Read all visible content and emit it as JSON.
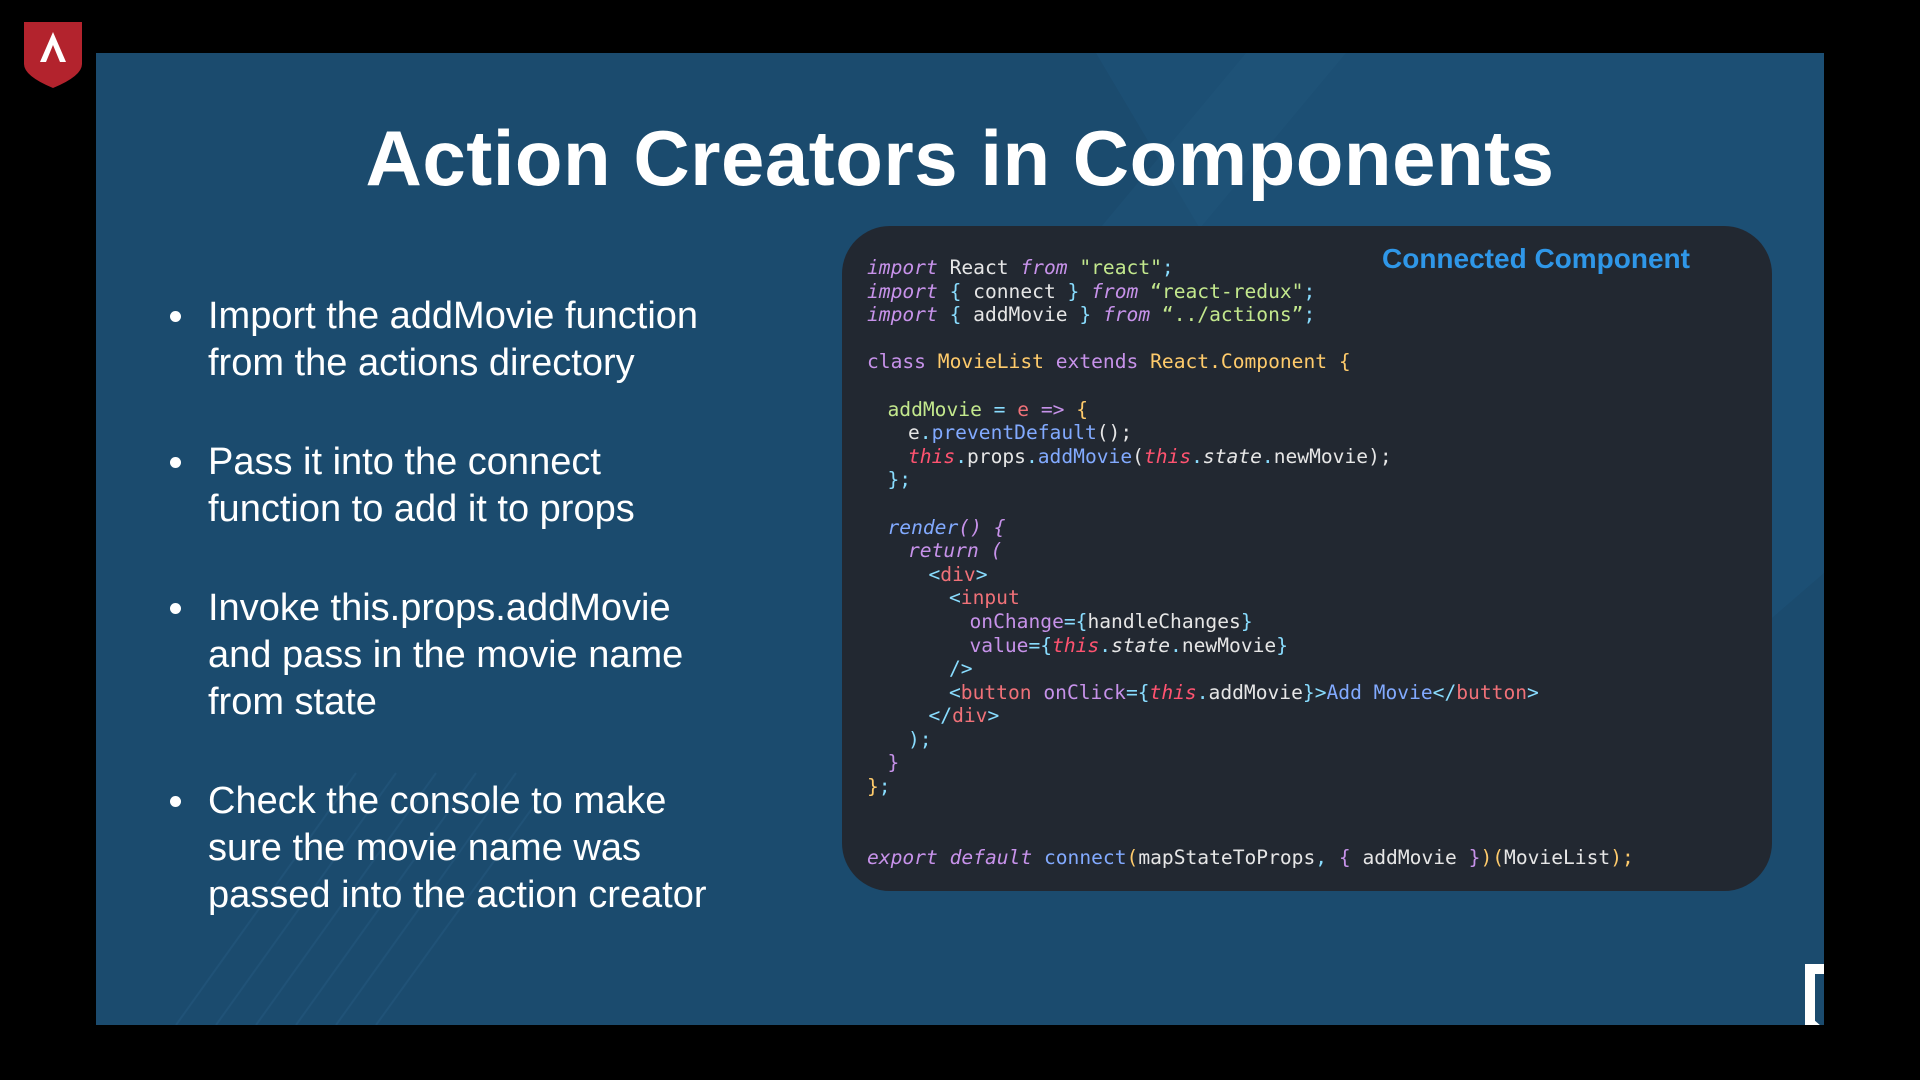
{
  "slide": {
    "title": "Action Creators in Components",
    "bullets": [
      "Import the addMovie function\nfrom the actions directory",
      "Pass it into the connect\nfunction to add it to props",
      "Invoke this.props.addMovie\nand pass in the movie name\nfrom state",
      "Check the console to make\nsure the movie name was\npassed into the action creator"
    ]
  },
  "code_panel": {
    "label": "Connected Component",
    "lines": [
      {
        "indent": 0,
        "tokens": [
          {
            "t": "import",
            "c": "kw"
          },
          {
            "t": " React ",
            "c": "plain"
          },
          {
            "t": "from",
            "c": "kw"
          },
          {
            "t": " \"react\"",
            "c": "str"
          },
          {
            "t": ";",
            "c": "punc"
          }
        ]
      },
      {
        "indent": 0,
        "tokens": [
          {
            "t": "import",
            "c": "kw"
          },
          {
            "t": " { ",
            "c": "punc"
          },
          {
            "t": "connect",
            "c": "plain"
          },
          {
            "t": " } ",
            "c": "punc"
          },
          {
            "t": "from",
            "c": "kw"
          },
          {
            "t": " “react-redux\"",
            "c": "str"
          },
          {
            "t": ";",
            "c": "punc"
          }
        ]
      },
      {
        "indent": 0,
        "tokens": [
          {
            "t": "import",
            "c": "kw"
          },
          {
            "t": " { ",
            "c": "punc"
          },
          {
            "t": "addMovie",
            "c": "plain"
          },
          {
            "t": " } ",
            "c": "punc"
          },
          {
            "t": "from",
            "c": "kw"
          },
          {
            "t": " “../actions”",
            "c": "str"
          },
          {
            "t": ";",
            "c": "punc"
          }
        ]
      },
      {
        "indent": 0,
        "tokens": []
      },
      {
        "indent": 0,
        "tokens": [
          {
            "t": "class",
            "c": "key"
          },
          {
            "t": " MovieList ",
            "c": "cls"
          },
          {
            "t": "extends",
            "c": "key"
          },
          {
            "t": " React.Component ",
            "c": "cls"
          },
          {
            "t": "{",
            "c": "brace"
          }
        ]
      },
      {
        "indent": 0,
        "tokens": []
      },
      {
        "indent": 1,
        "tokens": [
          {
            "t": "addMovie",
            "c": "def"
          },
          {
            "t": " = ",
            "c": "punc"
          },
          {
            "t": "e",
            "c": "tag"
          },
          {
            "t": " => ",
            "c": "key"
          },
          {
            "t": "{",
            "c": "brace"
          }
        ]
      },
      {
        "indent": 2,
        "tokens": [
          {
            "t": "e",
            "c": "plain"
          },
          {
            "t": ".",
            "c": "punc"
          },
          {
            "t": "preventDefault",
            "c": "fn"
          },
          {
            "t": "();",
            "c": "plain"
          }
        ]
      },
      {
        "indent": 2,
        "tokens": [
          {
            "t": "this",
            "c": "this"
          },
          {
            "t": ".",
            "c": "punc"
          },
          {
            "t": "props",
            "c": "plain"
          },
          {
            "t": ".",
            "c": "punc"
          },
          {
            "t": "addMovie",
            "c": "fn"
          },
          {
            "t": "(",
            "c": "plain"
          },
          {
            "t": "this",
            "c": "this"
          },
          {
            "t": ".",
            "c": "punc"
          },
          {
            "t": "state",
            "c": "ital"
          },
          {
            "t": ".",
            "c": "punc"
          },
          {
            "t": "newMovie",
            "c": "plain"
          },
          {
            "t": ");",
            "c": "plain"
          }
        ]
      },
      {
        "indent": 1,
        "tokens": [
          {
            "t": "};",
            "c": "punc"
          }
        ]
      },
      {
        "indent": 0,
        "tokens": []
      },
      {
        "indent": 1,
        "tokens": [
          {
            "t": "render",
            "c": "rfn"
          },
          {
            "t": "() ",
            "c": "kw"
          },
          {
            "t": "{",
            "c": "kw"
          }
        ]
      },
      {
        "indent": 2,
        "tokens": [
          {
            "t": "return",
            "c": "kw"
          },
          {
            "t": " (",
            "c": "kw"
          }
        ]
      },
      {
        "indent": 3,
        "tokens": [
          {
            "t": "<",
            "c": "punc"
          },
          {
            "t": "div",
            "c": "tag"
          },
          {
            "t": ">",
            "c": "punc"
          }
        ]
      },
      {
        "indent": 4,
        "tokens": [
          {
            "t": "<",
            "c": "punc"
          },
          {
            "t": "input",
            "c": "tag"
          }
        ]
      },
      {
        "indent": 5,
        "tokens": [
          {
            "t": "onChange",
            "c": "attr"
          },
          {
            "t": "={",
            "c": "punc"
          },
          {
            "t": "handleChanges",
            "c": "plain"
          },
          {
            "t": "}",
            "c": "punc"
          }
        ]
      },
      {
        "indent": 5,
        "tokens": [
          {
            "t": "value",
            "c": "attr"
          },
          {
            "t": "={",
            "c": "punc"
          },
          {
            "t": "this",
            "c": "this"
          },
          {
            "t": ".",
            "c": "punc"
          },
          {
            "t": "state",
            "c": "ital"
          },
          {
            "t": ".",
            "c": "punc"
          },
          {
            "t": "newMovie",
            "c": "plain"
          },
          {
            "t": "}",
            "c": "punc"
          }
        ]
      },
      {
        "indent": 4,
        "tokens": [
          {
            "t": "/>",
            "c": "punc"
          }
        ]
      },
      {
        "indent": 4,
        "tokens": [
          {
            "t": "<",
            "c": "punc"
          },
          {
            "t": "button",
            "c": "tag"
          },
          {
            "t": " onClick",
            "c": "attr"
          },
          {
            "t": "={",
            "c": "punc"
          },
          {
            "t": "this",
            "c": "this"
          },
          {
            "t": ".",
            "c": "punc"
          },
          {
            "t": "addMovie",
            "c": "plain"
          },
          {
            "t": "}>",
            "c": "punc"
          },
          {
            "t": "Add Movie",
            "c": "text"
          },
          {
            "t": "</",
            "c": "punc"
          },
          {
            "t": "button",
            "c": "tag"
          },
          {
            "t": ">",
            "c": "punc"
          }
        ]
      },
      {
        "indent": 3,
        "tokens": [
          {
            "t": "</",
            "c": "punc"
          },
          {
            "t": "div",
            "c": "tag"
          },
          {
            "t": ">",
            "c": "punc"
          }
        ]
      },
      {
        "indent": 2,
        "tokens": [
          {
            "t": ");",
            "c": "punc"
          }
        ]
      },
      {
        "indent": 1,
        "tokens": [
          {
            "t": "}",
            "c": "key"
          }
        ]
      },
      {
        "indent": 0,
        "tokens": [
          {
            "t": "}",
            "c": "brace"
          },
          {
            "t": ";",
            "c": "punc"
          }
        ]
      },
      {
        "indent": 0,
        "tokens": []
      },
      {
        "indent": 0,
        "tokens": []
      },
      {
        "indent": 0,
        "tokens": [
          {
            "t": "export",
            "c": "kw"
          },
          {
            "t": " default",
            "c": "kw"
          },
          {
            "t": " connect",
            "c": "fn"
          },
          {
            "t": "(",
            "c": "brace"
          },
          {
            "t": "mapStateToProps",
            "c": "plain"
          },
          {
            "t": ", ",
            "c": "punc"
          },
          {
            "t": "{ ",
            "c": "key"
          },
          {
            "t": "addMovie",
            "c": "plain"
          },
          {
            "t": " }",
            "c": "key"
          },
          {
            "t": ")(",
            "c": "brace"
          },
          {
            "t": "MovieList",
            "c": "plain"
          },
          {
            "t": ");",
            "c": "brace"
          }
        ]
      }
    ]
  },
  "icons": {
    "corner_badge": "lambda-shield-icon",
    "brand_logo": "lambda-shield-outline-icon"
  },
  "colors": {
    "slide_background": "#1b4b6e",
    "code_background": "#222831",
    "panel_label": "#2f97e8",
    "corner_badge": "#b3232d"
  }
}
